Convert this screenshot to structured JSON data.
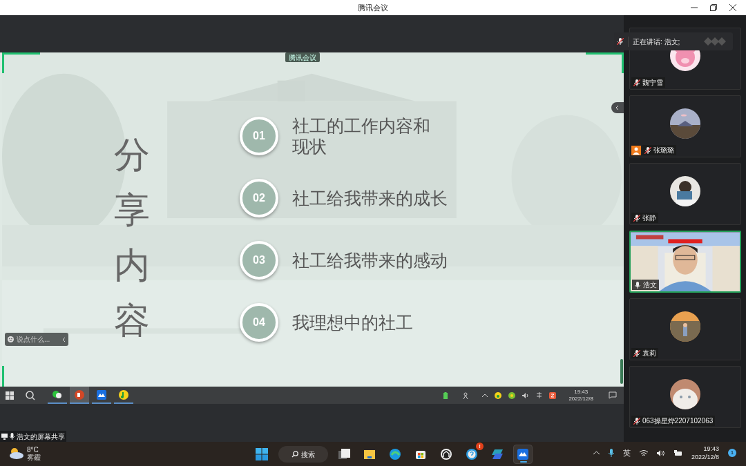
{
  "window": {
    "title": "腾讯会议"
  },
  "share": {
    "tag": "腾讯会议",
    "chat_placeholder": "说点什么...",
    "owner_label": "浩文的屏幕共享"
  },
  "slide": {
    "title": "分享内容",
    "items": [
      {
        "number": "01",
        "lines": [
          "社工的工作内容和",
          "现状"
        ]
      },
      {
        "number": "02",
        "lines": [
          "社工给我带来的成长"
        ]
      },
      {
        "number": "03",
        "lines": [
          "社工给我带来的感动"
        ]
      },
      {
        "number": "04",
        "lines": [
          "我理想中的社工"
        ]
      }
    ]
  },
  "shared_taskbar": {
    "apps": [
      {
        "kind": "chat",
        "selected": false
      },
      {
        "kind": "slides",
        "selected": true
      },
      {
        "kind": "meeting",
        "selected": false
      },
      {
        "kind": "music",
        "selected": false
      }
    ],
    "time": "19:43",
    "date": "2022/12/8"
  },
  "speaking_banner": "正在讲话: 浩文;",
  "participants": [
    {
      "name": "魏宁雪",
      "kind": "avatar",
      "muted": true,
      "speaking": false,
      "host": false
    },
    {
      "name": "张璐璐",
      "kind": "avatar",
      "muted": true,
      "speaking": false,
      "host": true
    },
    {
      "name": "张静",
      "kind": "avatar",
      "muted": true,
      "speaking": false,
      "host": false
    },
    {
      "name": "浩文",
      "kind": "video",
      "muted": false,
      "speaking": true,
      "host": false
    },
    {
      "name": "袁莉",
      "kind": "avatar",
      "muted": true,
      "speaking": false,
      "host": false
    },
    {
      "name": "063操星烨2207102063",
      "kind": "avatar",
      "muted": true,
      "speaking": false,
      "host": false
    }
  ],
  "taskbar": {
    "weather": {
      "temp": "8°C",
      "condition": "雾霾"
    },
    "search": "搜索",
    "apps": [
      {
        "kind": "files",
        "selected": false
      },
      {
        "kind": "explorer",
        "selected": false
      },
      {
        "kind": "browser",
        "selected": false
      },
      {
        "kind": "store",
        "selected": false
      },
      {
        "kind": "home",
        "selected": false
      },
      {
        "kind": "help",
        "selected": false,
        "badge": "!"
      },
      {
        "kind": "docs",
        "selected": false
      },
      {
        "kind": "meeting",
        "selected": true
      }
    ],
    "ime": "英",
    "time": "19:43",
    "date": "2022/12/8",
    "notifications": "1"
  }
}
